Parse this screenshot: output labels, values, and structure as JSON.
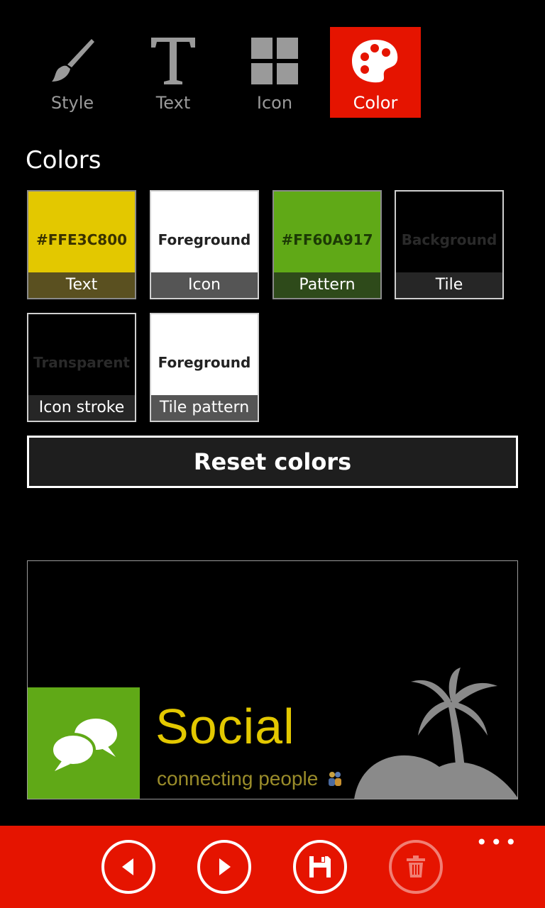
{
  "tabs": [
    {
      "label": "Style",
      "icon": "brush-icon",
      "active": false
    },
    {
      "label": "Text",
      "icon": "text-T-icon",
      "active": false
    },
    {
      "label": "Icon",
      "icon": "grid-icon",
      "active": false
    },
    {
      "label": "Color",
      "icon": "palette-icon",
      "active": true
    }
  ],
  "section_title": "Colors",
  "swatches": [
    {
      "value": "#FFE3C800",
      "caption": "Text",
      "fill": "#e3c800",
      "value_color": "#3a3200",
      "caption_bg": "#5a5020"
    },
    {
      "value": "Foreground",
      "caption": "Icon",
      "fill": "#ffffff",
      "value_color": "#222222",
      "caption_bg": "#555555"
    },
    {
      "value": "#FF60A917",
      "caption": "Pattern",
      "fill": "#60a917",
      "value_color": "#1c3a05",
      "caption_bg": "#2e4a1a"
    },
    {
      "value": "Background",
      "caption": "Tile",
      "fill": "#000000",
      "value_color": "#2a2a2a",
      "caption_bg": "#262626"
    },
    {
      "value": "Transparent",
      "caption": "Icon stroke",
      "fill": "#000000",
      "value_color": "#2a2a2a",
      "caption_bg": "#262626"
    },
    {
      "value": "Foreground",
      "caption": "Tile pattern",
      "fill": "#ffffff",
      "value_color": "#222222",
      "caption_bg": "#555555"
    }
  ],
  "reset_label": "Reset colors",
  "preview": {
    "title": "Social",
    "subtitle": "connecting people",
    "title_color": "#e3c800",
    "icon_bg": "#60a917",
    "icon": "chat-bubbles-icon"
  },
  "appbar": {
    "buttons": [
      "back-icon",
      "forward-icon",
      "save-icon",
      "delete-icon"
    ],
    "more": "•••",
    "accent": "#e51400"
  }
}
